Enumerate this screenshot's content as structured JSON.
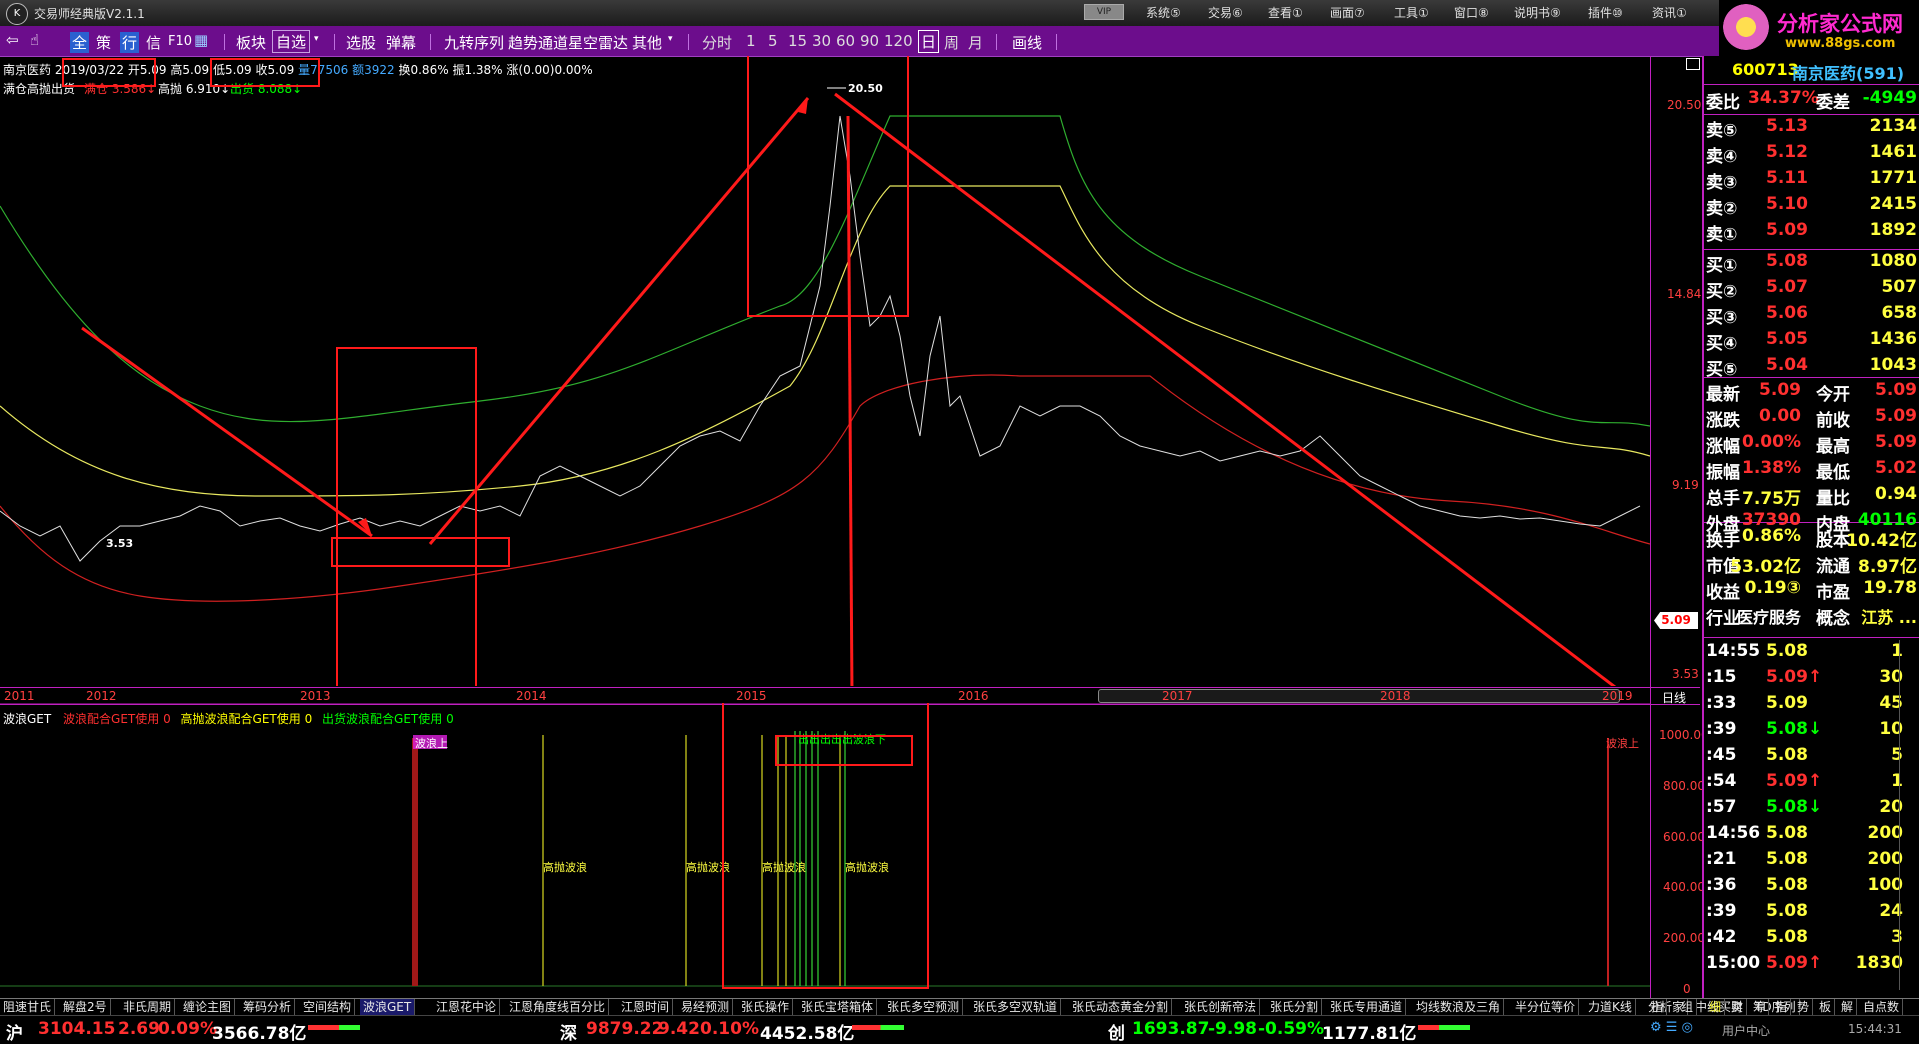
{
  "app": {
    "title": "交易师经典版V2.1.1",
    "vip": "VIP",
    "menus": [
      "系统⑤",
      "交易⑥",
      "查看①",
      "画面⑦",
      "工具①",
      "窗口⑧",
      "说明书⑨",
      "插件⑩",
      "资讯①"
    ],
    "logo_glyph": "K"
  },
  "brand": {
    "name": "分析家公式网",
    "url": "www.88gs.com"
  },
  "toolbar": {
    "items": [
      "全",
      "策",
      "行",
      "信",
      "F10",
      "板块",
      "自选",
      "选股",
      "弹幕",
      "九转序列",
      "趋势通道",
      "星空雷达",
      "其他",
      "分时",
      "1",
      "5",
      "15",
      "30",
      "60",
      "90",
      "120",
      "日",
      "周",
      "月",
      "画线"
    ]
  },
  "main": {
    "stock_name": "南京医药",
    "date": "2019/03/22",
    "open": "开5.09",
    "high": "高5.09",
    "low": "低5.09",
    "close": "收5.09",
    "volume": "量77506",
    "amount": "额3922",
    "turnover": "换0.86%",
    "amplitude": "振1.38%",
    "change": "涨(0.00)0.00%",
    "ind_name": "满仓高抛出货",
    "ind_mancang": "满仓 3.586↓",
    "ind_gaopao": "高抛 6.910↓",
    "ind_chuhuo": "出货 8.088↓",
    "price_max_label": "20.50",
    "price_min_label": "3.53",
    "last_price_tag": "5.09",
    "yaxis": [
      "20.50",
      "14.84",
      "9.19",
      "3.53"
    ],
    "years": [
      "2011",
      "2012",
      "2013",
      "2014",
      "2015",
      "2016",
      "2017",
      "2018",
      "2019"
    ],
    "period_label": "日线"
  },
  "sub": {
    "title": "波浪GET",
    "l1": "波浪配合GET使用 0",
    "l2": "高抛波浪配合GET使用 0",
    "l3": "出货波浪配合GET使用 0",
    "yaxis": [
      "1000.00",
      "800.00",
      "600.00",
      "400.00",
      "200.00",
      "0"
    ],
    "labels": {
      "up": "波浪上",
      "up2": "波浪上",
      "down": "出出出出出波浪下",
      "gp": "高抛波浪"
    }
  },
  "quote": {
    "code": "600713",
    "name": "南京医药(591)",
    "webi": {
      "k1": "委比",
      "v1": "34.37%",
      "k2": "委差",
      "v2": "-4949"
    },
    "sell": [
      [
        "卖⑤",
        "5.13",
        "2134"
      ],
      [
        "卖④",
        "5.12",
        "1461"
      ],
      [
        "卖③",
        "5.11",
        "1771"
      ],
      [
        "卖②",
        "5.10",
        "2415"
      ],
      [
        "卖①",
        "5.09",
        "1892"
      ]
    ],
    "buy": [
      [
        "买①",
        "5.08",
        "1080"
      ],
      [
        "买②",
        "5.07",
        "507"
      ],
      [
        "买③",
        "5.06",
        "658"
      ],
      [
        "买④",
        "5.05",
        "1436"
      ],
      [
        "买⑤",
        "5.04",
        "1043"
      ]
    ],
    "stats": [
      [
        "最新",
        "5.09",
        "今开",
        "5.09"
      ],
      [
        "涨跌",
        "0.00",
        "前收",
        "5.09"
      ],
      [
        "涨幅",
        "0.00%",
        "最高",
        "5.09"
      ],
      [
        "振幅",
        "1.38%",
        "最低",
        "5.02"
      ],
      [
        "总手",
        "7.75万",
        "量比",
        "0.94"
      ],
      [
        "外盘",
        "37390",
        "内盘",
        "40116"
      ]
    ],
    "stats2": [
      [
        "换手",
        "0.86%",
        "股本",
        "10.42亿"
      ],
      [
        "市值",
        "53.02亿",
        "流通",
        "8.97亿"
      ],
      [
        "收益",
        "0.19③",
        "市盈",
        "19.78"
      ],
      [
        "行业",
        "医疗服务",
        "概念",
        "江苏 ..."
      ]
    ],
    "ticks": [
      [
        "14:55",
        "5.08",
        "1"
      ],
      [
        ":15",
        "5.09↑",
        "30"
      ],
      [
        ":33",
        "5.09",
        "45"
      ],
      [
        ":39",
        "5.08↓",
        "10"
      ],
      [
        ":45",
        "5.08",
        "5"
      ],
      [
        ":54",
        "5.09↑",
        "1"
      ],
      [
        ":57",
        "5.08↓",
        "20"
      ],
      [
        "14:56",
        "5.08",
        "200"
      ],
      [
        ":21",
        "5.08",
        "200"
      ],
      [
        ":36",
        "5.08",
        "100"
      ],
      [
        ":39",
        "5.08",
        "24"
      ],
      [
        ":42",
        "5.08",
        "3"
      ],
      [
        "15:00",
        "5.09↑",
        "1830"
      ]
    ]
  },
  "tabs": [
    "阻速甘氏",
    "解盘2号",
    "非氏周期",
    "缠论主图",
    "筹码分析",
    "空间结构",
    "波浪GET",
    "江恩花中论",
    "江恩角度线百分比",
    "江恩时间",
    "易经预测",
    "张氏操作",
    "张氏宝塔箱体",
    "张氏多空预测",
    "张氏多空双轨道",
    "张氏动态黄金分割",
    "张氏创新帝法",
    "张氏分割",
    "张氏专用通道",
    "均线数浪及三角",
    "半分位等价",
    "力道K线",
    "分析家",
    "中线买卖",
    "TD序列"
  ],
  "right_tabs": [
    "指",
    "组"
  ],
  "quote_tabs": [
    "细",
    "财",
    "筹",
    "指",
    "势",
    "板",
    "解",
    "自点数"
  ],
  "status": {
    "sh": "沪",
    "sh_idx": "3104.15",
    "sh_chg": "2.69",
    "sh_pct": "0.09%",
    "sh_amt": "3566.78亿",
    "sz": "深",
    "sz_idx": "9879.22",
    "sz_chg": "9.42",
    "sz_pct": "0.10%",
    "sz_amt": "4452.58亿",
    "cy": "创",
    "cy_idx": "1693.87",
    "cy_chg": "-9.98",
    "cy_pct": "-0.59%",
    "cy_amt": "1177.81亿",
    "user": "用户中心",
    "time": "15:44:31"
  },
  "colors": {
    "accent": "#6c0d8c",
    "up": "#ff3030",
    "down": "#40ffff",
    "yellow": "#ffff00",
    "green": "#00ff00"
  }
}
